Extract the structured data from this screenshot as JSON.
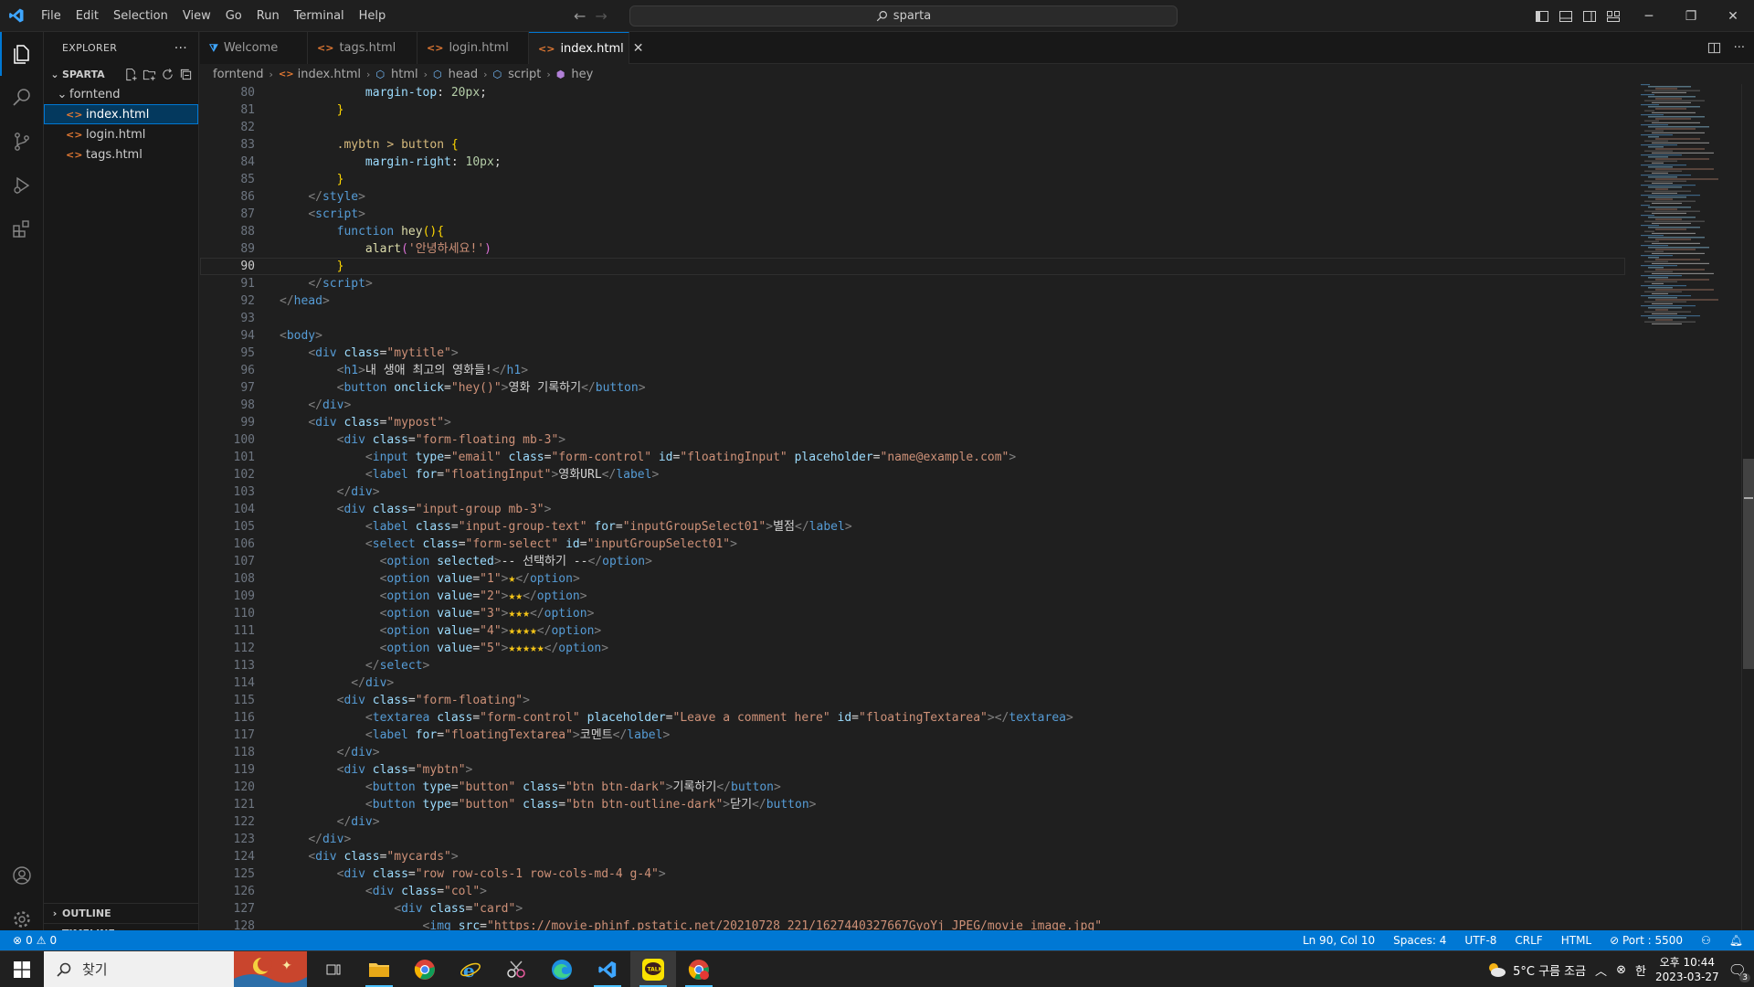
{
  "titlebar": {
    "menu": [
      "File",
      "Edit",
      "Selection",
      "View",
      "Go",
      "Run",
      "Terminal",
      "Help"
    ],
    "search_text": "sparta"
  },
  "sidebar": {
    "title": "EXPLORER",
    "more": "···",
    "root": "SPARTA",
    "folder": "forntend",
    "files": [
      "index.html",
      "login.html",
      "tags.html"
    ],
    "outline": "OUTLINE",
    "timeline": "TIMELINE"
  },
  "tabs": [
    {
      "label": "Welcome"
    },
    {
      "label": "tags.html"
    },
    {
      "label": "login.html"
    },
    {
      "label": "index.html"
    }
  ],
  "breadcrumb": [
    "forntend",
    "index.html",
    "html",
    "head",
    "script",
    "hey"
  ],
  "editor": {
    "current_line": 90,
    "lines": [
      {
        "n": 80,
        "html": "            <span class=\"an\">margin-top</span><span class=\"pn\">: </span><span class=\"nu\">20px</span><span class=\"pn\">;</span>"
      },
      {
        "n": 81,
        "html": "        <span class=\"br\">}</span>"
      },
      {
        "n": 82,
        "html": ""
      },
      {
        "n": 83,
        "html": "        <span class=\"cs\">.mybtn &gt; button</span> <span class=\"br\">{</span>"
      },
      {
        "n": 84,
        "html": "            <span class=\"an\">margin-right</span><span class=\"pn\">: </span><span class=\"nu\">10px</span><span class=\"pn\">;</span>"
      },
      {
        "n": 85,
        "html": "        <span class=\"br\">}</span>"
      },
      {
        "n": 86,
        "html": "    <span class=\"tg\">&lt;/</span><span class=\"tn\">style</span><span class=\"tg\">&gt;</span>"
      },
      {
        "n": 87,
        "html": "    <span class=\"tg\">&lt;</span><span class=\"tn\">script</span><span class=\"tg\">&gt;</span>"
      },
      {
        "n": 88,
        "html": "        <span class=\"kw\">function</span> <span class=\"fn\">hey</span><span class=\"br\">()</span><span class=\"br\">{</span>"
      },
      {
        "n": 89,
        "html": "            <span class=\"fn\">alart</span><span class=\"br2\">(</span><span class=\"av\">'안녕하세요!'</span><span class=\"br2\">)</span>"
      },
      {
        "n": 90,
        "html": "        <span class=\"br\">}</span>"
      },
      {
        "n": 91,
        "html": "    <span class=\"tg\">&lt;/</span><span class=\"tn\">script</span><span class=\"tg\">&gt;</span>"
      },
      {
        "n": 92,
        "html": "<span class=\"tg\">&lt;/</span><span class=\"tn\">head</span><span class=\"tg\">&gt;</span>"
      },
      {
        "n": 93,
        "html": ""
      },
      {
        "n": 94,
        "html": "<span class=\"tg\">&lt;</span><span class=\"tn\">body</span><span class=\"tg\">&gt;</span>"
      },
      {
        "n": 95,
        "html": "    <span class=\"tg\">&lt;</span><span class=\"tn\">div</span> <span class=\"an\">class</span><span class=\"pn\">=</span><span class=\"av\">\"mytitle\"</span><span class=\"tg\">&gt;</span>"
      },
      {
        "n": 96,
        "html": "        <span class=\"tg\">&lt;</span><span class=\"tn\">h1</span><span class=\"tg\">&gt;</span>내 생애 최고의 영화들!<span class=\"tg\">&lt;/</span><span class=\"tn\">h1</span><span class=\"tg\">&gt;</span>"
      },
      {
        "n": 97,
        "html": "        <span class=\"tg\">&lt;</span><span class=\"tn\">button</span> <span class=\"an\">onclick</span><span class=\"pn\">=</span><span class=\"av\">\"hey()\"</span><span class=\"tg\">&gt;</span>영화 기록하기<span class=\"tg\">&lt;/</span><span class=\"tn\">button</span><span class=\"tg\">&gt;</span>"
      },
      {
        "n": 98,
        "html": "    <span class=\"tg\">&lt;/</span><span class=\"tn\">div</span><span class=\"tg\">&gt;</span>"
      },
      {
        "n": 99,
        "html": "    <span class=\"tg\">&lt;</span><span class=\"tn\">div</span> <span class=\"an\">class</span><span class=\"pn\">=</span><span class=\"av\">\"mypost\"</span><span class=\"tg\">&gt;</span>"
      },
      {
        "n": 100,
        "html": "        <span class=\"tg\">&lt;</span><span class=\"tn\">div</span> <span class=\"an\">class</span><span class=\"pn\">=</span><span class=\"av\">\"form-floating mb-3\"</span><span class=\"tg\">&gt;</span>"
      },
      {
        "n": 101,
        "html": "            <span class=\"tg\">&lt;</span><span class=\"tn\">input</span> <span class=\"an\">type</span><span class=\"pn\">=</span><span class=\"av\">\"email\"</span> <span class=\"an\">class</span><span class=\"pn\">=</span><span class=\"av\">\"form-control\"</span> <span class=\"an\">id</span><span class=\"pn\">=</span><span class=\"av\">\"floatingInput\"</span> <span class=\"an\">placeholder</span><span class=\"pn\">=</span><span class=\"av\">\"name@example.com\"</span><span class=\"tg\">&gt;</span>"
      },
      {
        "n": 102,
        "html": "            <span class=\"tg\">&lt;</span><span class=\"tn\">label</span> <span class=\"an\">for</span><span class=\"pn\">=</span><span class=\"av\">\"floatingInput\"</span><span class=\"tg\">&gt;</span>영화URL<span class=\"tg\">&lt;/</span><span class=\"tn\">label</span><span class=\"tg\">&gt;</span>"
      },
      {
        "n": 103,
        "html": "        <span class=\"tg\">&lt;/</span><span class=\"tn\">div</span><span class=\"tg\">&gt;</span>"
      },
      {
        "n": 104,
        "html": "        <span class=\"tg\">&lt;</span><span class=\"tn\">div</span> <span class=\"an\">class</span><span class=\"pn\">=</span><span class=\"av\">\"input-group mb-3\"</span><span class=\"tg\">&gt;</span>"
      },
      {
        "n": 105,
        "html": "            <span class=\"tg\">&lt;</span><span class=\"tn\">label</span> <span class=\"an\">class</span><span class=\"pn\">=</span><span class=\"av\">\"input-group-text\"</span> <span class=\"an\">for</span><span class=\"pn\">=</span><span class=\"av\">\"inputGroupSelect01\"</span><span class=\"tg\">&gt;</span>별점<span class=\"tg\">&lt;/</span><span class=\"tn\">label</span><span class=\"tg\">&gt;</span>"
      },
      {
        "n": 106,
        "html": "            <span class=\"tg\">&lt;</span><span class=\"tn\">select</span> <span class=\"an\">class</span><span class=\"pn\">=</span><span class=\"av\">\"form-select\"</span> <span class=\"an\">id</span><span class=\"pn\">=</span><span class=\"av\">\"inputGroupSelect01\"</span><span class=\"tg\">&gt;</span>"
      },
      {
        "n": 107,
        "html": "              <span class=\"tg\">&lt;</span><span class=\"tn\">option</span> <span class=\"an\">selected</span><span class=\"tg\">&gt;</span>-- 선택하기 --<span class=\"tg\">&lt;/</span><span class=\"tn\">option</span><span class=\"tg\">&gt;</span>"
      },
      {
        "n": 108,
        "html": "              <span class=\"tg\">&lt;</span><span class=\"tn\">option</span> <span class=\"an\">value</span><span class=\"pn\">=</span><span class=\"av\">\"1\"</span><span class=\"tg\">&gt;</span><span class=\"star\">★</span><span class=\"tg\">&lt;/</span><span class=\"tn\">option</span><span class=\"tg\">&gt;</span>"
      },
      {
        "n": 109,
        "html": "              <span class=\"tg\">&lt;</span><span class=\"tn\">option</span> <span class=\"an\">value</span><span class=\"pn\">=</span><span class=\"av\">\"2\"</span><span class=\"tg\">&gt;</span><span class=\"star\">★★</span><span class=\"tg\">&lt;/</span><span class=\"tn\">option</span><span class=\"tg\">&gt;</span>"
      },
      {
        "n": 110,
        "html": "              <span class=\"tg\">&lt;</span><span class=\"tn\">option</span> <span class=\"an\">value</span><span class=\"pn\">=</span><span class=\"av\">\"3\"</span><span class=\"tg\">&gt;</span><span class=\"star\">★★★</span><span class=\"tg\">&lt;/</span><span class=\"tn\">option</span><span class=\"tg\">&gt;</span>"
      },
      {
        "n": 111,
        "html": "              <span class=\"tg\">&lt;</span><span class=\"tn\">option</span> <span class=\"an\">value</span><span class=\"pn\">=</span><span class=\"av\">\"4\"</span><span class=\"tg\">&gt;</span><span class=\"star\">★★★★</span><span class=\"tg\">&lt;/</span><span class=\"tn\">option</span><span class=\"tg\">&gt;</span>"
      },
      {
        "n": 112,
        "html": "              <span class=\"tg\">&lt;</span><span class=\"tn\">option</span> <span class=\"an\">value</span><span class=\"pn\">=</span><span class=\"av\">\"5\"</span><span class=\"tg\">&gt;</span><span class=\"star\">★★★★★</span><span class=\"tg\">&lt;/</span><span class=\"tn\">option</span><span class=\"tg\">&gt;</span>"
      },
      {
        "n": 113,
        "html": "            <span class=\"tg\">&lt;/</span><span class=\"tn\">select</span><span class=\"tg\">&gt;</span>"
      },
      {
        "n": 114,
        "html": "          <span class=\"tg\">&lt;/</span><span class=\"tn\">div</span><span class=\"tg\">&gt;</span>"
      },
      {
        "n": 115,
        "html": "        <span class=\"tg\">&lt;</span><span class=\"tn\">div</span> <span class=\"an\">class</span><span class=\"pn\">=</span><span class=\"av\">\"form-floating\"</span><span class=\"tg\">&gt;</span>"
      },
      {
        "n": 116,
        "html": "            <span class=\"tg\">&lt;</span><span class=\"tn\">textarea</span> <span class=\"an\">class</span><span class=\"pn\">=</span><span class=\"av\">\"form-control\"</span> <span class=\"an\">placeholder</span><span class=\"pn\">=</span><span class=\"av\">\"Leave a comment here\"</span> <span class=\"an\">id</span><span class=\"pn\">=</span><span class=\"av\">\"floatingTextarea\"</span><span class=\"tg\">&gt;&lt;/</span><span class=\"tn\">textarea</span><span class=\"tg\">&gt;</span>"
      },
      {
        "n": 117,
        "html": "            <span class=\"tg\">&lt;</span><span class=\"tn\">label</span> <span class=\"an\">for</span><span class=\"pn\">=</span><span class=\"av\">\"floatingTextarea\"</span><span class=\"tg\">&gt;</span>코멘트<span class=\"tg\">&lt;/</span><span class=\"tn\">label</span><span class=\"tg\">&gt;</span>"
      },
      {
        "n": 118,
        "html": "        <span class=\"tg\">&lt;/</span><span class=\"tn\">div</span><span class=\"tg\">&gt;</span>"
      },
      {
        "n": 119,
        "html": "        <span class=\"tg\">&lt;</span><span class=\"tn\">div</span> <span class=\"an\">class</span><span class=\"pn\">=</span><span class=\"av\">\"mybtn\"</span><span class=\"tg\">&gt;</span>"
      },
      {
        "n": 120,
        "html": "            <span class=\"tg\">&lt;</span><span class=\"tn\">button</span> <span class=\"an\">type</span><span class=\"pn\">=</span><span class=\"av\">\"button\"</span> <span class=\"an\">class</span><span class=\"pn\">=</span><span class=\"av\">\"btn btn-dark\"</span><span class=\"tg\">&gt;</span>기록하기<span class=\"tg\">&lt;/</span><span class=\"tn\">button</span><span class=\"tg\">&gt;</span>"
      },
      {
        "n": 121,
        "html": "            <span class=\"tg\">&lt;</span><span class=\"tn\">button</span> <span class=\"an\">type</span><span class=\"pn\">=</span><span class=\"av\">\"button\"</span> <span class=\"an\">class</span><span class=\"pn\">=</span><span class=\"av\">\"btn btn-outline-dark\"</span><span class=\"tg\">&gt;</span>닫기<span class=\"tg\">&lt;/</span><span class=\"tn\">button</span><span class=\"tg\">&gt;</span>"
      },
      {
        "n": 122,
        "html": "        <span class=\"tg\">&lt;/</span><span class=\"tn\">div</span><span class=\"tg\">&gt;</span>"
      },
      {
        "n": 123,
        "html": "    <span class=\"tg\">&lt;/</span><span class=\"tn\">div</span><span class=\"tg\">&gt;</span>"
      },
      {
        "n": 124,
        "html": "    <span class=\"tg\">&lt;</span><span class=\"tn\">div</span> <span class=\"an\">class</span><span class=\"pn\">=</span><span class=\"av\">\"mycards\"</span><span class=\"tg\">&gt;</span>"
      },
      {
        "n": 125,
        "html": "        <span class=\"tg\">&lt;</span><span class=\"tn\">div</span> <span class=\"an\">class</span><span class=\"pn\">=</span><span class=\"av\">\"row row-cols-1 row-cols-md-4 g-4\"</span><span class=\"tg\">&gt;</span>"
      },
      {
        "n": 126,
        "html": "            <span class=\"tg\">&lt;</span><span class=\"tn\">div</span> <span class=\"an\">class</span><span class=\"pn\">=</span><span class=\"av\">\"col\"</span><span class=\"tg\">&gt;</span>"
      },
      {
        "n": 127,
        "html": "                <span class=\"tg\">&lt;</span><span class=\"tn\">div</span> <span class=\"an\">class</span><span class=\"pn\">=</span><span class=\"av\">\"card\"</span><span class=\"tg\">&gt;</span>"
      },
      {
        "n": 128,
        "html": "                    <span class=\"tg\">&lt;</span><span class=\"tn\">img</span> <span class=\"an\">src</span><span class=\"pn\">=</span><span class=\"av\">\"https://movie-phinf.pstatic.net/20210728_221/1627440327667GyoYj_JPEG/movie_image.jpg\"</span>"
      }
    ]
  },
  "statusbar": {
    "errors": "0",
    "warnings": "0",
    "position": "Ln 90, Col 10",
    "spaces": "Spaces: 4",
    "encoding": "UTF-8",
    "eol": "CRLF",
    "language": "HTML",
    "port": "Port : 5500"
  },
  "taskbar": {
    "search_placeholder": "찾기",
    "weather": "5°C  구름 조금",
    "ime": "한",
    "time": "오후 10:44",
    "date": "2023-03-27",
    "notification_count": "3"
  }
}
